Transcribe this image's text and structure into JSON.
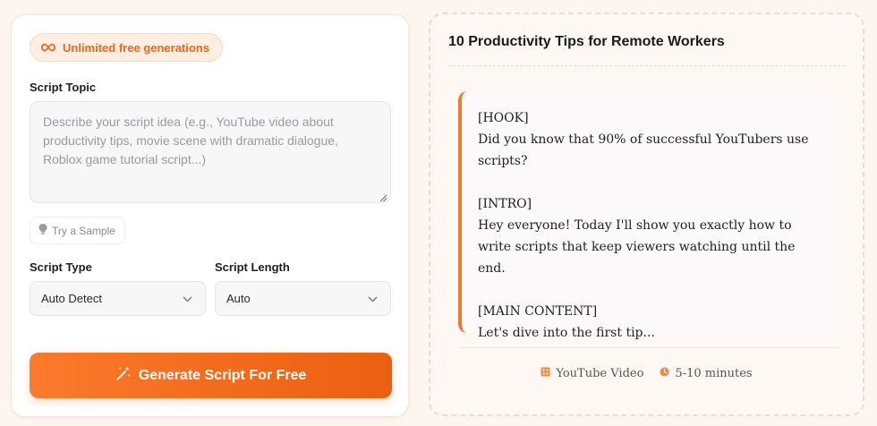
{
  "form": {
    "badge_label": "Unlimited free generations",
    "topic_label": "Script Topic",
    "topic_value": "",
    "topic_placeholder": "Describe your script idea (e.g., YouTube video about productivity tips, movie scene with dramatic dialogue, Roblox game tutorial script...)",
    "sample_label": "Try a Sample",
    "type_label": "Script Type",
    "type_value": "Auto Detect",
    "length_label": "Script Length",
    "length_value": "Auto",
    "generate_label": "Generate Script For Free"
  },
  "preview": {
    "title": "10 Productivity Tips for Remote Workers",
    "sections": [
      {
        "heading": "[HOOK]",
        "text": "Did you know that 90% of successful YouTubers use scripts?"
      },
      {
        "heading": "[INTRO]",
        "text": "Hey everyone! Today I'll show you exactly how to write scripts that keep viewers watching until the end."
      },
      {
        "heading": "[MAIN CONTENT]",
        "text": "Let's dive into the first tip..."
      }
    ],
    "meta": {
      "platform": "YouTube Video",
      "duration": "5-10 minutes"
    }
  },
  "colors": {
    "accent": "#f26a1b",
    "page_background": "#fdf5ef",
    "badge_background": "#fdeee3"
  },
  "icons": {
    "badge": "infinity-icon",
    "sample": "lightbulb-icon",
    "select": "chevron-down-icon",
    "generate": "magic-wand-icon",
    "platform": "video-icon",
    "duration": "clock-icon"
  }
}
